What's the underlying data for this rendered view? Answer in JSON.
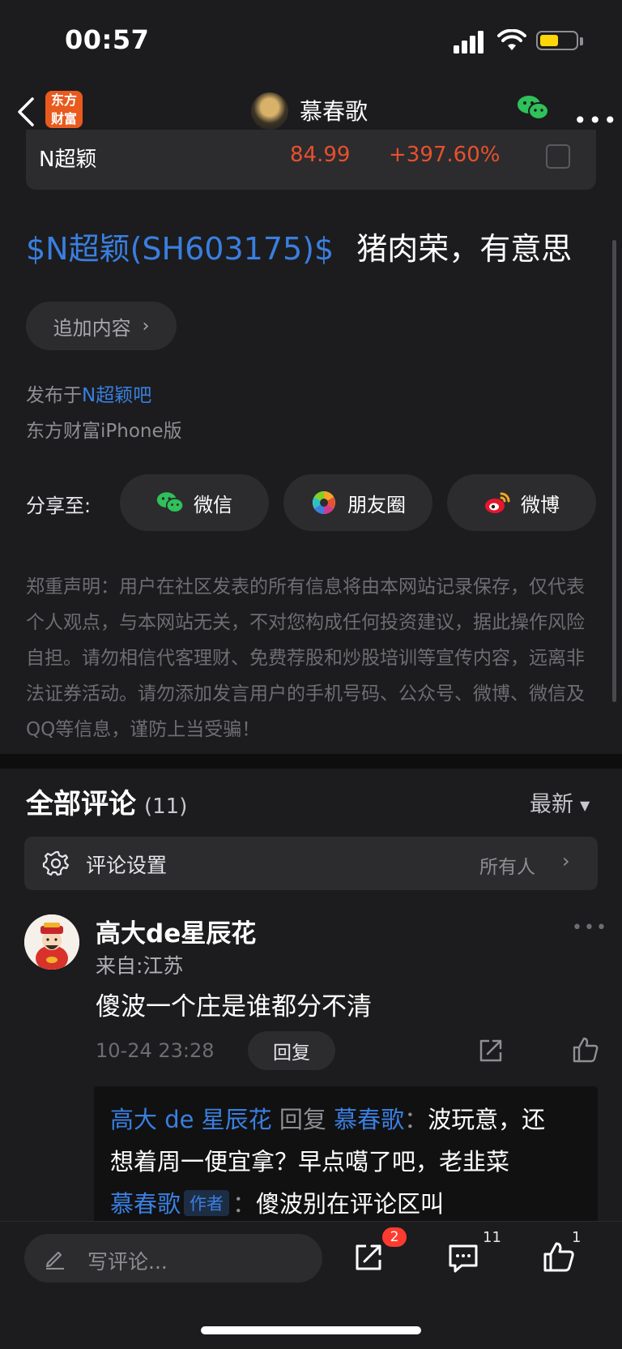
{
  "status_bar": {
    "time": "00:57"
  },
  "nav": {
    "app_logo_line1": "东方",
    "app_logo_line2": "财富",
    "title": "慕春歌"
  },
  "stock": {
    "name": "N超颖",
    "price": "84.99",
    "change_pct": "+397.60%"
  },
  "post": {
    "stock_link": "$N超颖(SH603175)$",
    "text": "猪肉荣，有意思",
    "append_label": "追加内容",
    "published_prefix": "发布于",
    "forum": "N超颖吧",
    "device": "东方财富iPhone版"
  },
  "share": {
    "label": "分享至:",
    "wechat": "微信",
    "moments": "朋友圈",
    "weibo": "微博"
  },
  "disclaimer": "郑重声明：用户在社区发表的所有信息将由本网站记录保存，仅代表个人观点，与本网站无关，不对您构成任何投资建议，据此操作风险自担。请勿相信代客理财、免费荐股和炒股培训等宣传内容，远离非法证券活动。请勿添加发言用户的手机号码、公众号、微博、微信及QQ等信息，谨防上当受骗！",
  "comments": {
    "title": "全部评论",
    "count": "(11)",
    "sort": "最新",
    "settings_label": "评论设置",
    "settings_value": "所有人",
    "items": [
      {
        "name": "高大de星辰花",
        "from": "来自:江苏",
        "text": "傻波一个庄是谁都分不清",
        "time": "10-24 23:28",
        "reply_label": "回复",
        "replies": [
          {
            "user": "高大 de 星辰花",
            "mid": "回复",
            "target": "慕春歌",
            "text_line1": "波玩意，还",
            "text_line2": "想着周一便宜拿？早点噶了吧，老韭菜"
          },
          {
            "user": "慕春歌",
            "tag": "作者",
            "text": "傻波别在评论区叫"
          }
        ]
      }
    ]
  },
  "bottom_bar": {
    "placeholder": "写评论...",
    "share_badge": "2",
    "comment_count": "11",
    "like_count": "1"
  },
  "colors": {
    "background": "#1c1c1e",
    "accent_link": "#3a7fe0",
    "price_red": "#e8502e",
    "badge_red": "#ff3b30",
    "battery_yellow": "#ffd60a"
  }
}
